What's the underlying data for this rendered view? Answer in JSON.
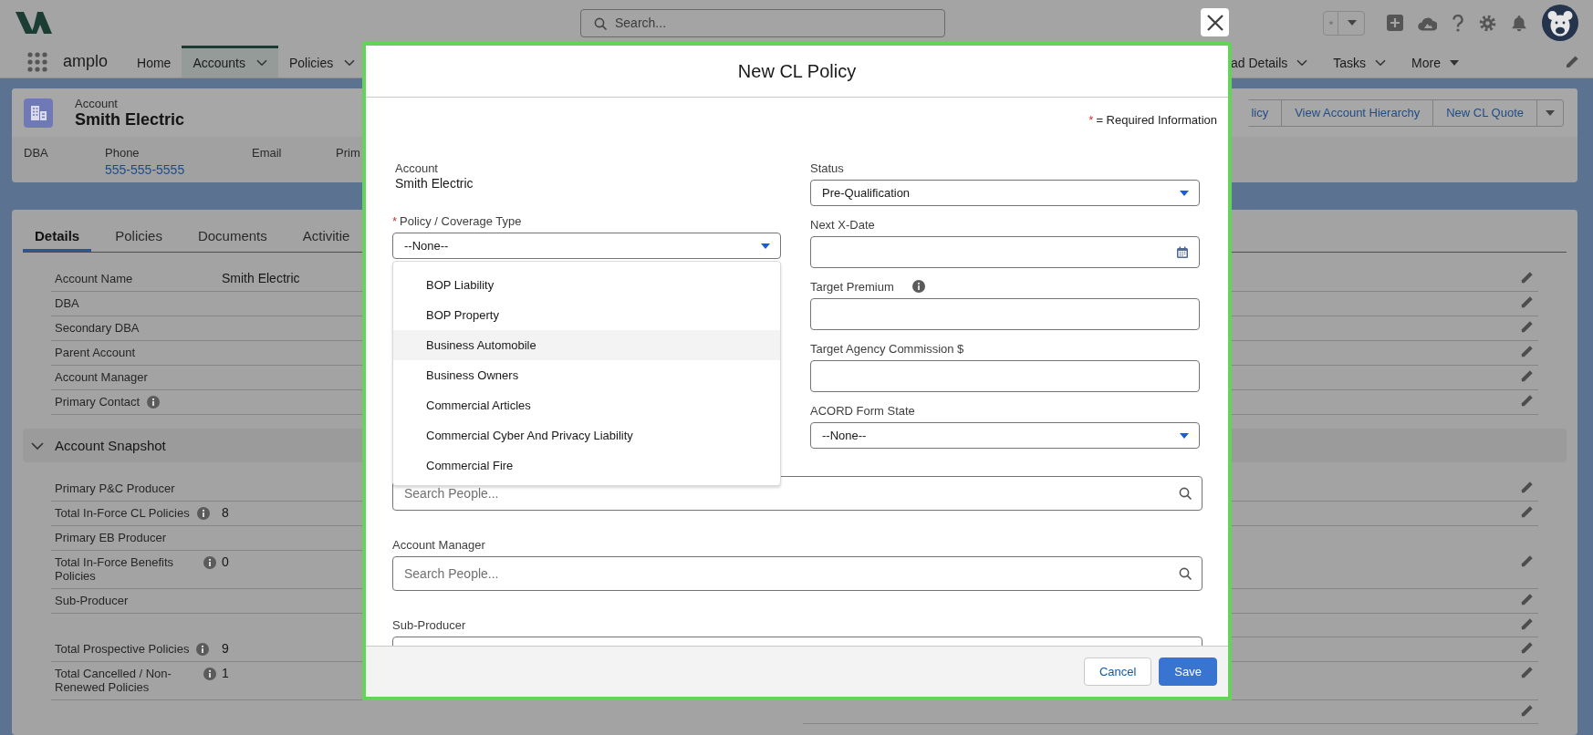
{
  "app": {
    "search_placeholder": "Search...",
    "name": "amplo"
  },
  "nav": {
    "items": [
      {
        "label": "Home",
        "kind": "plain",
        "selected": false
      },
      {
        "label": "Accounts",
        "kind": "menu",
        "selected": true
      },
      {
        "label": "Policies",
        "kind": "menu",
        "selected": false
      }
    ],
    "items_right": [
      {
        "label": "ad Details",
        "kind": "menu",
        "selected": false
      },
      {
        "label": "Tasks",
        "kind": "menu",
        "selected": false
      },
      {
        "label": "More",
        "kind": "overflow",
        "selected": false
      }
    ]
  },
  "record": {
    "object": "Account",
    "name": "Smith Electric",
    "actions": [
      "licy",
      "View Account Hierarchy",
      "New CL Quote"
    ],
    "highlights": [
      {
        "label": "DBA"
      },
      {
        "label": "Phone",
        "value": "555-555-5555"
      },
      {
        "label": "Email"
      },
      {
        "label": "Prim"
      }
    ]
  },
  "tabs": [
    {
      "label": "Details",
      "selected": true
    },
    {
      "label": "Policies",
      "selected": false
    },
    {
      "label": "Documents",
      "selected": false
    },
    {
      "label": "Activitie",
      "selected": false
    }
  ],
  "sections": [
    {
      "kind": "plain",
      "rows": [
        {
          "kind": "field",
          "label": "Account Name",
          "value": "Smith Electric",
          "editable": true
        },
        {
          "kind": "field",
          "label": "DBA",
          "editable": true
        },
        {
          "kind": "field",
          "label": "Secondary DBA",
          "editable": true
        },
        {
          "kind": "field",
          "label": "Parent Account",
          "editable": true
        },
        {
          "kind": "field",
          "label": "Account Manager",
          "editable": true
        },
        {
          "kind": "field",
          "label": "Primary Contact",
          "info": true,
          "editable": true
        }
      ]
    },
    {
      "kind": "collapsible",
      "title": "Account Snapshot",
      "expanded": true,
      "rows": [
        {
          "kind": "field",
          "label": "Primary P&C Producer",
          "editable": true
        },
        {
          "kind": "field",
          "label": "Total In-Force CL Policies",
          "value": "8",
          "info": true,
          "editable": true
        },
        {
          "kind": "field",
          "label": "Primary EB Producer"
        },
        {
          "kind": "field",
          "label": "Total In-Force Benefits Policies",
          "value": "0",
          "info": true,
          "editable": true
        },
        {
          "kind": "field",
          "label": "Sub-Producer",
          "editable": true
        },
        {
          "kind": "blank",
          "editable": true
        },
        {
          "kind": "field",
          "label": "Total Prospective Policies",
          "value": "9",
          "info": true,
          "editable": true
        },
        {
          "kind": "field",
          "label": "Total Cancelled / Non-Renewed Policies",
          "value": "1",
          "info": true,
          "editable": true
        },
        {
          "kind": "blank",
          "editable": true
        }
      ]
    }
  ],
  "modal": {
    "title": "New CL Policy",
    "legend": {
      "mark": "*",
      "text": "= Required Information"
    },
    "left": [
      {
        "kind": "readonly",
        "label": "Account",
        "value": "Smith Electric"
      },
      {
        "kind": "select",
        "label": "Policy / Coverage Type",
        "mark": "*",
        "value": "--None--",
        "open": true,
        "options": [
          {
            "label": "BOP Liability",
            "highlighted": false
          },
          {
            "label": "BOP Property",
            "highlighted": false
          },
          {
            "label": "Business Automobile",
            "highlighted": true
          },
          {
            "label": "Business Owners",
            "highlighted": false
          },
          {
            "label": "Commercial Articles",
            "highlighted": false
          },
          {
            "label": "Commercial Cyber And Privacy Liability",
            "highlighted": false
          },
          {
            "label": "Commercial Fire",
            "highlighted": false
          }
        ]
      }
    ],
    "right": [
      {
        "kind": "select",
        "label": "Status",
        "value": "Pre-Qualification"
      },
      {
        "kind": "date",
        "label": "Next X-Date"
      },
      {
        "kind": "text",
        "label": "Target Premium",
        "info": true
      },
      {
        "kind": "text",
        "label": "Target Agency Commission $"
      },
      {
        "kind": "select",
        "label": "ACORD Form State",
        "value": "--None--"
      }
    ],
    "full": [
      {
        "kind": "lookup",
        "placeholder": "Search People..."
      },
      {
        "kind": "lookup",
        "label": "Account Manager",
        "placeholder": "Search People..."
      },
      {
        "kind": "lookup",
        "label": "Sub-Producer"
      }
    ],
    "buttons": [
      {
        "label": "Cancel",
        "kind": "neutral"
      },
      {
        "label": "Save",
        "kind": "brand"
      }
    ]
  }
}
